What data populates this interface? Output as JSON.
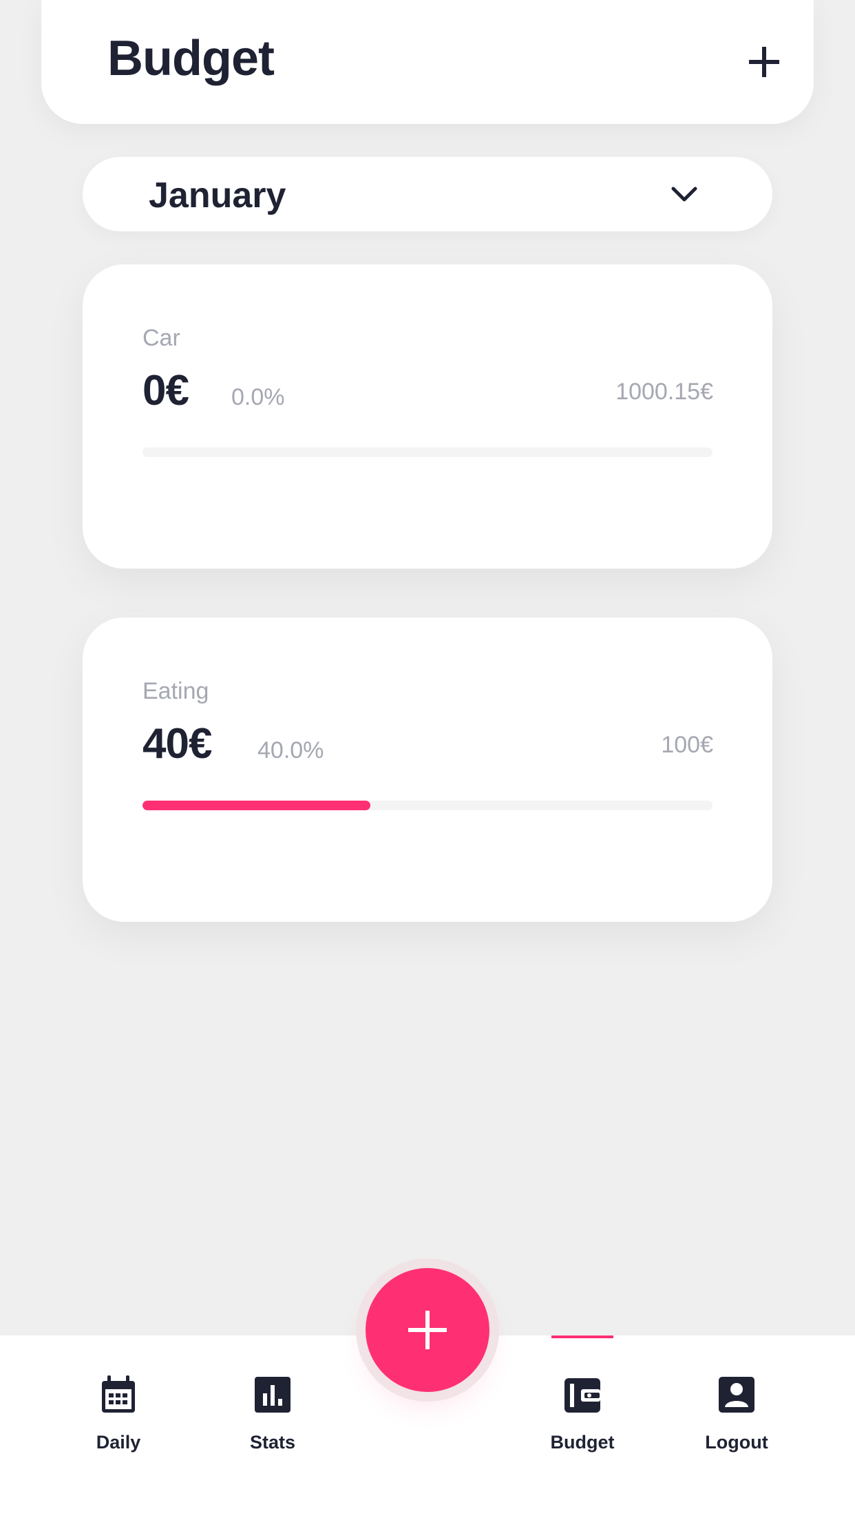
{
  "header": {
    "title": "Budget"
  },
  "month_selector": {
    "selected": "January"
  },
  "budgets": [
    {
      "category": "Car",
      "spent": "0€",
      "percent_label": "0.0%",
      "limit": "1000.15€",
      "progress": 0.0
    },
    {
      "category": "Eating",
      "spent": "40€",
      "percent_label": "40.0%",
      "limit": "100€",
      "progress": 0.4
    }
  ],
  "nav": {
    "items": [
      {
        "label": "Daily",
        "icon": "calendar-icon"
      },
      {
        "label": "Stats",
        "icon": "bar-chart-icon"
      },
      {
        "label": "Budget",
        "icon": "wallet-icon",
        "active": true
      },
      {
        "label": "Logout",
        "icon": "account-icon"
      }
    ]
  },
  "colors": {
    "accent": "#ff2f73",
    "text_dark": "#1f2233",
    "text_muted": "#a5a7b1",
    "background": "#efefef"
  }
}
